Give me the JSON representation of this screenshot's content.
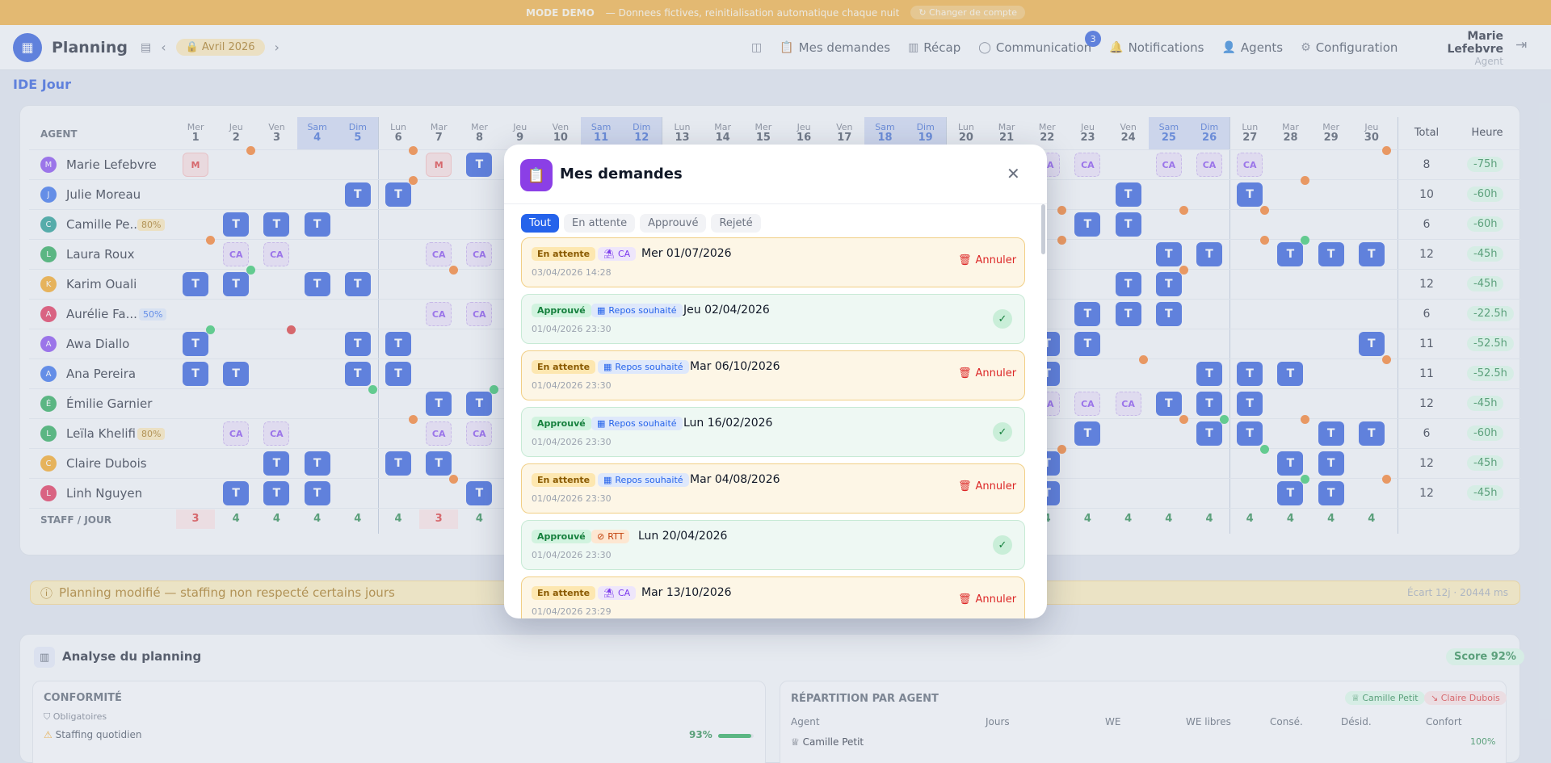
{
  "banner": {
    "mode": "MODE DEMO",
    "text": "— Donnees fictives, reinitialisation automatique chaque nuit",
    "switch_label": "Changer de compte"
  },
  "header": {
    "app_title": "Planning",
    "month": "Avril 2026",
    "nav": [
      {
        "label": "Mes demandes",
        "icon": "clipboard-icon"
      },
      {
        "label": "Récap",
        "icon": "bar-chart-icon"
      },
      {
        "label": "Communication",
        "icon": "chat-icon",
        "badge": "3"
      },
      {
        "label": "Notifications",
        "icon": "bell-icon"
      },
      {
        "label": "Agents",
        "icon": "user-icon"
      },
      {
        "label": "Configuration",
        "icon": "gear-icon"
      }
    ],
    "user_name": "Marie Lefebvre",
    "user_role": "Agent"
  },
  "section_title": "IDE Jour",
  "grid": {
    "agent_header": "AGENT",
    "total_header": "Total",
    "hours_header": "Heure",
    "staff_label": "STAFF / JOUR",
    "days": [
      {
        "dn": "Mer",
        "n": "1"
      },
      {
        "dn": "Jeu",
        "n": "2"
      },
      {
        "dn": "Ven",
        "n": "3"
      },
      {
        "dn": "Sam",
        "n": "4",
        "we": true
      },
      {
        "dn": "Dim",
        "n": "5",
        "we": true
      },
      {
        "dn": "Lun",
        "n": "6"
      },
      {
        "dn": "Mar",
        "n": "7"
      },
      {
        "dn": "Mer",
        "n": "8"
      },
      {
        "dn": "Jeu",
        "n": "9"
      },
      {
        "dn": "Ven",
        "n": "10"
      },
      {
        "dn": "Sam",
        "n": "11",
        "we": true
      },
      {
        "dn": "Dim",
        "n": "12",
        "we": true
      },
      {
        "dn": "Lun",
        "n": "13"
      },
      {
        "dn": "Mar",
        "n": "14"
      },
      {
        "dn": "Mer",
        "n": "15"
      },
      {
        "dn": "Jeu",
        "n": "16"
      },
      {
        "dn": "Ven",
        "n": "17"
      },
      {
        "dn": "Sam",
        "n": "18",
        "we": true
      },
      {
        "dn": "Dim",
        "n": "19",
        "we": true
      },
      {
        "dn": "Lun",
        "n": "20"
      },
      {
        "dn": "Mar",
        "n": "21"
      },
      {
        "dn": "Mer",
        "n": "22"
      },
      {
        "dn": "Jeu",
        "n": "23"
      },
      {
        "dn": "Ven",
        "n": "24"
      },
      {
        "dn": "Sam",
        "n": "25",
        "we": true
      },
      {
        "dn": "Dim",
        "n": "26",
        "we": true
      },
      {
        "dn": "Lun",
        "n": "27"
      },
      {
        "dn": "Mar",
        "n": "28"
      },
      {
        "dn": "Mer",
        "n": "29"
      },
      {
        "dn": "Jeu",
        "n": "30"
      }
    ],
    "agents": [
      {
        "initial": "M",
        "name": "Marie Lefebvre",
        "color": "#7c3aed",
        "total": "8",
        "hours": "-75h",
        "cells": {
          "0": "M",
          "6": "M",
          "7": "T",
          "21": "CA",
          "22": "CA",
          "24": "CA",
          "25": "CA",
          "26": "CA"
        }
      },
      {
        "initial": "J",
        "name": "Julie Moreau",
        "color": "#2563eb",
        "total": "10",
        "hours": "-60h",
        "cells": {
          "4": "T",
          "5": "T",
          "23": "T",
          "26": "T"
        }
      },
      {
        "initial": "C",
        "name": "Camille Pe...",
        "color": "#0d9488",
        "pct": "80%",
        "total": "6",
        "hours": "-60h",
        "cells": {
          "1": "T",
          "2": "T",
          "3": "T",
          "22": "T",
          "23": "T"
        }
      },
      {
        "initial": "L",
        "name": "Laura Roux",
        "color": "#16a34a",
        "total": "12",
        "hours": "-45h",
        "cells": {
          "1": "CA",
          "2": "CA",
          "6": "CA",
          "7": "CA",
          "24": "T",
          "25": "T",
          "27": "T",
          "28": "T",
          "29": "T"
        }
      },
      {
        "initial": "K",
        "name": "Karim Ouali",
        "color": "#f59e0b",
        "total": "12",
        "hours": "-45h",
        "cells": {
          "0": "T",
          "1": "T",
          "3": "T",
          "4": "T",
          "23": "T",
          "24": "T"
        }
      },
      {
        "initial": "A",
        "name": "Aurélie Fa...",
        "color": "#e11d48",
        "pct": "50%",
        "total": "6",
        "hours": "-22.5h",
        "cells": {
          "6": "CA",
          "7": "CA",
          "22": "T",
          "23": "T",
          "24": "T"
        }
      },
      {
        "initial": "A",
        "name": "Awa Diallo",
        "color": "#7c3aed",
        "total": "11",
        "hours": "-52.5h",
        "cells": {
          "0": "T",
          "4": "T",
          "5": "T",
          "21": "T",
          "22": "T",
          "29": "T"
        }
      },
      {
        "initial": "A",
        "name": "Ana Pereira",
        "color": "#2563eb",
        "total": "11",
        "hours": "-52.5h",
        "cells": {
          "0": "T",
          "1": "T",
          "4": "T",
          "5": "T",
          "21": "T",
          "25": "T",
          "26": "T",
          "27": "T"
        }
      },
      {
        "initial": "É",
        "name": "Émilie Garnier",
        "color": "#16a34a",
        "total": "12",
        "hours": "-45h",
        "cells": {
          "6": "T",
          "7": "T",
          "21": "CA",
          "22": "CA",
          "23": "CA",
          "24": "T",
          "25": "T",
          "26": "T"
        }
      },
      {
        "initial": "L",
        "name": "Leïla Khelifi",
        "color": "#16a34a",
        "pct": "80%",
        "total": "6",
        "hours": "-60h",
        "cells": {
          "1": "CA",
          "2": "CA",
          "6": "CA",
          "7": "CA",
          "22": "T",
          "25": "T",
          "26": "T",
          "28": "T",
          "29": "T"
        }
      },
      {
        "initial": "C",
        "name": "Claire Dubois",
        "color": "#f59e0b",
        "total": "12",
        "hours": "-45h",
        "cells": {
          "2": "T",
          "3": "T",
          "5": "T",
          "6": "T",
          "21": "T",
          "27": "T",
          "28": "T"
        }
      },
      {
        "initial": "L",
        "name": "Linh Nguyen",
        "color": "#e11d48",
        "total": "12",
        "hours": "-45h",
        "cells": {
          "1": "T",
          "2": "T",
          "3": "T",
          "7": "T",
          "21": "T",
          "27": "T",
          "28": "T"
        }
      }
    ],
    "staff": [
      "3",
      "4",
      "4",
      "4",
      "4",
      "4",
      "3",
      "4",
      "",
      "",
      "",
      "",
      "",
      "",
      "",
      "",
      "",
      "",
      "",
      "",
      "",
      "4",
      "4",
      "4",
      "4",
      "4",
      "4",
      "4",
      "4",
      "4"
    ]
  },
  "warning": {
    "text": "Planning modifié — staffing non respecté certains jours",
    "right": "Écart 12j · 20444 ms"
  },
  "analysis": {
    "title": "Analyse du planning",
    "score": "Score 92%",
    "conformite": {
      "title": "CONFORMITÉ",
      "obligatoires": "Obligatoires",
      "staffing_label": "Staffing quotidien",
      "staffing_value": "93%",
      "staffing_fraction": 0.93
    },
    "repartition": {
      "title": "RÉPARTITION PAR AGENT",
      "tag_good": "Camille Petit",
      "tag_bad": "Claire Dubois",
      "columns": [
        "Agent",
        "Jours",
        "WE",
        "WE libres",
        "Consé.",
        "Désid.",
        "Confort"
      ],
      "first_row": "Camille Petit",
      "first_row_comfort": "100%"
    }
  },
  "modal": {
    "title": "Mes demandes",
    "tabs": [
      "Tout",
      "En attente",
      "Approuvé",
      "Rejeté"
    ],
    "cancel_label": "Annuler",
    "requests": [
      {
        "status": "En attente",
        "status_key": "pending",
        "type": "CA",
        "type_key": "CA",
        "date": "Mer 01/07/2026",
        "sub": "03/04/2026 14:28"
      },
      {
        "status": "Approuvé",
        "status_key": "approved",
        "type": "Repos souhaité",
        "type_key": "Repos",
        "date": "Jeu 02/04/2026",
        "sub": "01/04/2026 23:30"
      },
      {
        "status": "En attente",
        "status_key": "pending",
        "type": "Repos souhaité",
        "type_key": "Repos",
        "date": "Mar 06/10/2026",
        "sub": "01/04/2026 23:30"
      },
      {
        "status": "Approuvé",
        "status_key": "approved",
        "type": "Repos souhaité",
        "type_key": "Repos",
        "date": "Lun 16/02/2026",
        "sub": "01/04/2026 23:30"
      },
      {
        "status": "En attente",
        "status_key": "pending",
        "type": "Repos souhaité",
        "type_key": "Repos",
        "date": "Mar 04/08/2026",
        "sub": "01/04/2026 23:30"
      },
      {
        "status": "Approuvé",
        "status_key": "approved",
        "type": "RTT",
        "type_key": "RTT",
        "date": "Lun 20/04/2026",
        "sub": "01/04/2026 23:30"
      },
      {
        "status": "En attente",
        "status_key": "pending",
        "type": "CA",
        "type_key": "CA",
        "date": "Mar 13/10/2026",
        "sub": "01/04/2026 23:29"
      }
    ]
  }
}
